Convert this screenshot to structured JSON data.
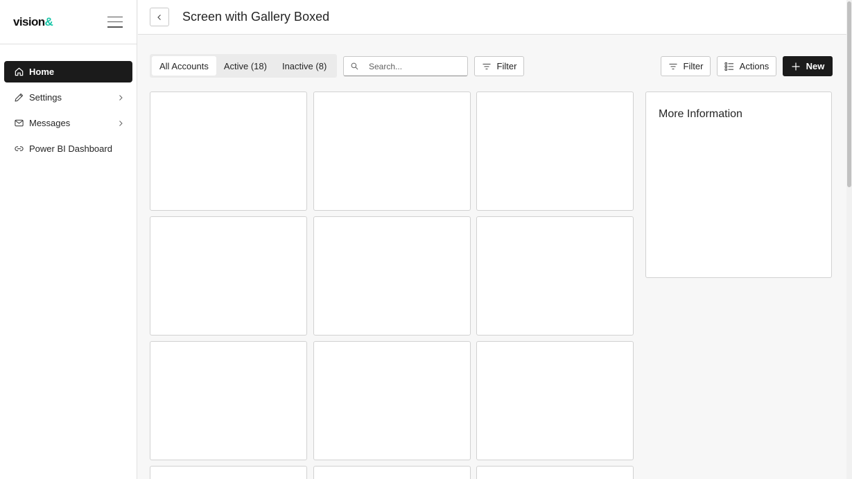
{
  "brand": {
    "name": "vision",
    "accent": "&"
  },
  "sidebar": {
    "items": [
      {
        "label": "Home",
        "icon": "home-icon",
        "active": true
      },
      {
        "label": "Settings",
        "icon": "pencil-icon",
        "hasChildren": true
      },
      {
        "label": "Messages",
        "icon": "mail-icon",
        "hasChildren": true
      },
      {
        "label": "Power BI Dashboard",
        "icon": "link-icon"
      }
    ]
  },
  "header": {
    "title": "Screen with Gallery Boxed"
  },
  "toolbar": {
    "tabs": [
      {
        "label": "All Accounts",
        "active": true
      },
      {
        "label": "Active (18)"
      },
      {
        "label": "Inactive (8)"
      }
    ],
    "search_placeholder": "Search...",
    "filter_label": "Filter",
    "filter2_label": "Filter",
    "actions_label": "Actions",
    "new_label": "New"
  },
  "info_panel": {
    "title": "More Information"
  },
  "colors": {
    "primary": "#1b1b1b",
    "brand_accent": "#18c6a8",
    "border": "#d1d1d1",
    "background": "#f7f7f7"
  }
}
